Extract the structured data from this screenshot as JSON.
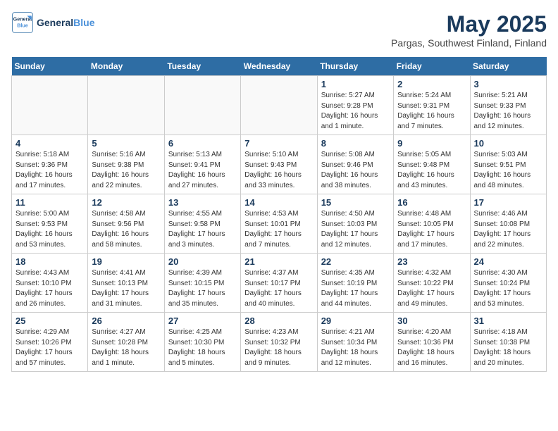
{
  "logo": {
    "line1": "General",
    "line2": "Blue"
  },
  "title": "May 2025",
  "subtitle": "Pargas, Southwest Finland, Finland",
  "headers": [
    "Sunday",
    "Monday",
    "Tuesday",
    "Wednesday",
    "Thursday",
    "Friday",
    "Saturday"
  ],
  "weeks": [
    [
      {
        "day": "",
        "info": ""
      },
      {
        "day": "",
        "info": ""
      },
      {
        "day": "",
        "info": ""
      },
      {
        "day": "",
        "info": ""
      },
      {
        "day": "1",
        "info": "Sunrise: 5:27 AM\nSunset: 9:28 PM\nDaylight: 16 hours\nand 1 minute."
      },
      {
        "day": "2",
        "info": "Sunrise: 5:24 AM\nSunset: 9:31 PM\nDaylight: 16 hours\nand 7 minutes."
      },
      {
        "day": "3",
        "info": "Sunrise: 5:21 AM\nSunset: 9:33 PM\nDaylight: 16 hours\nand 12 minutes."
      }
    ],
    [
      {
        "day": "4",
        "info": "Sunrise: 5:18 AM\nSunset: 9:36 PM\nDaylight: 16 hours\nand 17 minutes."
      },
      {
        "day": "5",
        "info": "Sunrise: 5:16 AM\nSunset: 9:38 PM\nDaylight: 16 hours\nand 22 minutes."
      },
      {
        "day": "6",
        "info": "Sunrise: 5:13 AM\nSunset: 9:41 PM\nDaylight: 16 hours\nand 27 minutes."
      },
      {
        "day": "7",
        "info": "Sunrise: 5:10 AM\nSunset: 9:43 PM\nDaylight: 16 hours\nand 33 minutes."
      },
      {
        "day": "8",
        "info": "Sunrise: 5:08 AM\nSunset: 9:46 PM\nDaylight: 16 hours\nand 38 minutes."
      },
      {
        "day": "9",
        "info": "Sunrise: 5:05 AM\nSunset: 9:48 PM\nDaylight: 16 hours\nand 43 minutes."
      },
      {
        "day": "10",
        "info": "Sunrise: 5:03 AM\nSunset: 9:51 PM\nDaylight: 16 hours\nand 48 minutes."
      }
    ],
    [
      {
        "day": "11",
        "info": "Sunrise: 5:00 AM\nSunset: 9:53 PM\nDaylight: 16 hours\nand 53 minutes."
      },
      {
        "day": "12",
        "info": "Sunrise: 4:58 AM\nSunset: 9:56 PM\nDaylight: 16 hours\nand 58 minutes."
      },
      {
        "day": "13",
        "info": "Sunrise: 4:55 AM\nSunset: 9:58 PM\nDaylight: 17 hours\nand 3 minutes."
      },
      {
        "day": "14",
        "info": "Sunrise: 4:53 AM\nSunset: 10:01 PM\nDaylight: 17 hours\nand 7 minutes."
      },
      {
        "day": "15",
        "info": "Sunrise: 4:50 AM\nSunset: 10:03 PM\nDaylight: 17 hours\nand 12 minutes."
      },
      {
        "day": "16",
        "info": "Sunrise: 4:48 AM\nSunset: 10:05 PM\nDaylight: 17 hours\nand 17 minutes."
      },
      {
        "day": "17",
        "info": "Sunrise: 4:46 AM\nSunset: 10:08 PM\nDaylight: 17 hours\nand 22 minutes."
      }
    ],
    [
      {
        "day": "18",
        "info": "Sunrise: 4:43 AM\nSunset: 10:10 PM\nDaylight: 17 hours\nand 26 minutes."
      },
      {
        "day": "19",
        "info": "Sunrise: 4:41 AM\nSunset: 10:13 PM\nDaylight: 17 hours\nand 31 minutes."
      },
      {
        "day": "20",
        "info": "Sunrise: 4:39 AM\nSunset: 10:15 PM\nDaylight: 17 hours\nand 35 minutes."
      },
      {
        "day": "21",
        "info": "Sunrise: 4:37 AM\nSunset: 10:17 PM\nDaylight: 17 hours\nand 40 minutes."
      },
      {
        "day": "22",
        "info": "Sunrise: 4:35 AM\nSunset: 10:19 PM\nDaylight: 17 hours\nand 44 minutes."
      },
      {
        "day": "23",
        "info": "Sunrise: 4:32 AM\nSunset: 10:22 PM\nDaylight: 17 hours\nand 49 minutes."
      },
      {
        "day": "24",
        "info": "Sunrise: 4:30 AM\nSunset: 10:24 PM\nDaylight: 17 hours\nand 53 minutes."
      }
    ],
    [
      {
        "day": "25",
        "info": "Sunrise: 4:29 AM\nSunset: 10:26 PM\nDaylight: 17 hours\nand 57 minutes."
      },
      {
        "day": "26",
        "info": "Sunrise: 4:27 AM\nSunset: 10:28 PM\nDaylight: 18 hours\nand 1 minute."
      },
      {
        "day": "27",
        "info": "Sunrise: 4:25 AM\nSunset: 10:30 PM\nDaylight: 18 hours\nand 5 minutes."
      },
      {
        "day": "28",
        "info": "Sunrise: 4:23 AM\nSunset: 10:32 PM\nDaylight: 18 hours\nand 9 minutes."
      },
      {
        "day": "29",
        "info": "Sunrise: 4:21 AM\nSunset: 10:34 PM\nDaylight: 18 hours\nand 12 minutes."
      },
      {
        "day": "30",
        "info": "Sunrise: 4:20 AM\nSunset: 10:36 PM\nDaylight: 18 hours\nand 16 minutes."
      },
      {
        "day": "31",
        "info": "Sunrise: 4:18 AM\nSunset: 10:38 PM\nDaylight: 18 hours\nand 20 minutes."
      }
    ]
  ]
}
